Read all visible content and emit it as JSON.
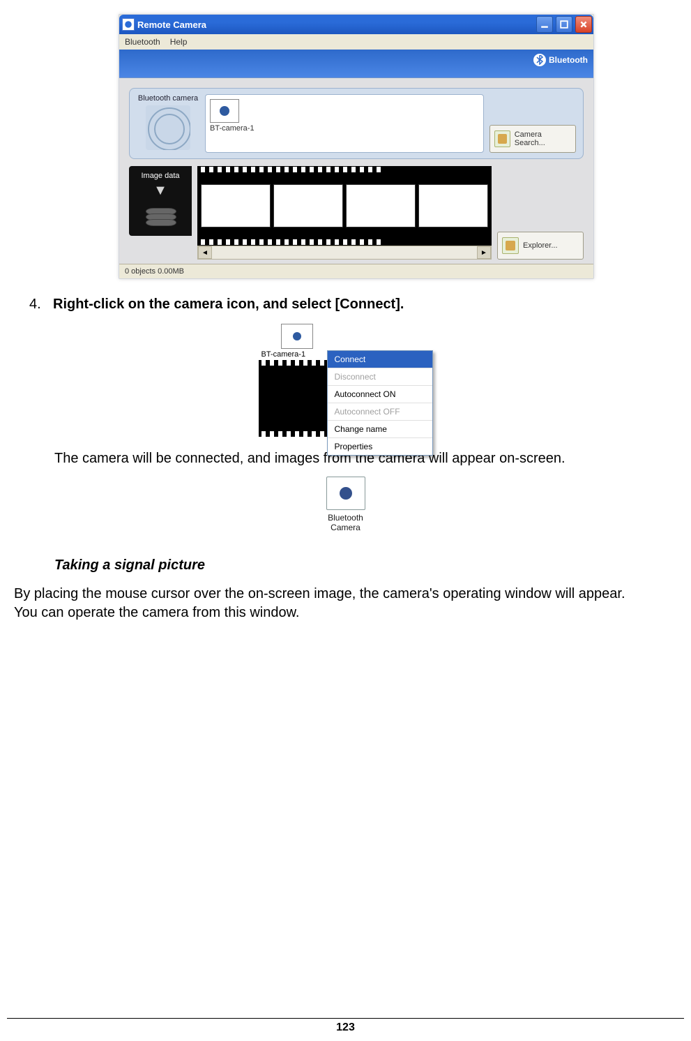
{
  "window": {
    "title": "Remote Camera",
    "menu": {
      "item1": "Bluetooth",
      "item2": "Help"
    },
    "brand": "Bluetooth",
    "bt_tab": "Bluetooth camera",
    "cam_label": "BT-camera-1",
    "btn_search": "Camera Search...",
    "btn_explorer": "Explorer...",
    "imgdata_label": "Image data",
    "status": "0 objects 0.00MB"
  },
  "step": {
    "num": "4.",
    "text": "Right-click on the camera icon, and select [Connect]."
  },
  "context_menu": {
    "cam_name": "BT-camera-1",
    "items": {
      "connect": "Connect",
      "disconnect": "Disconnect",
      "auto_on": "Autoconnect ON",
      "auto_off": "Autoconnect OFF",
      "change": "Change name",
      "props": "Properties"
    }
  },
  "result_text": "The camera will be connected, and images from the camera will appear on-screen.",
  "desktop_icon": {
    "line1": "Bluetooth",
    "line2": "Camera"
  },
  "subheading": "Taking a signal picture",
  "para1": "By placing the mouse cursor over the on-screen image, the camera's operating window will appear.",
  "para2": "You can operate the camera from this window.",
  "page_number": "123"
}
